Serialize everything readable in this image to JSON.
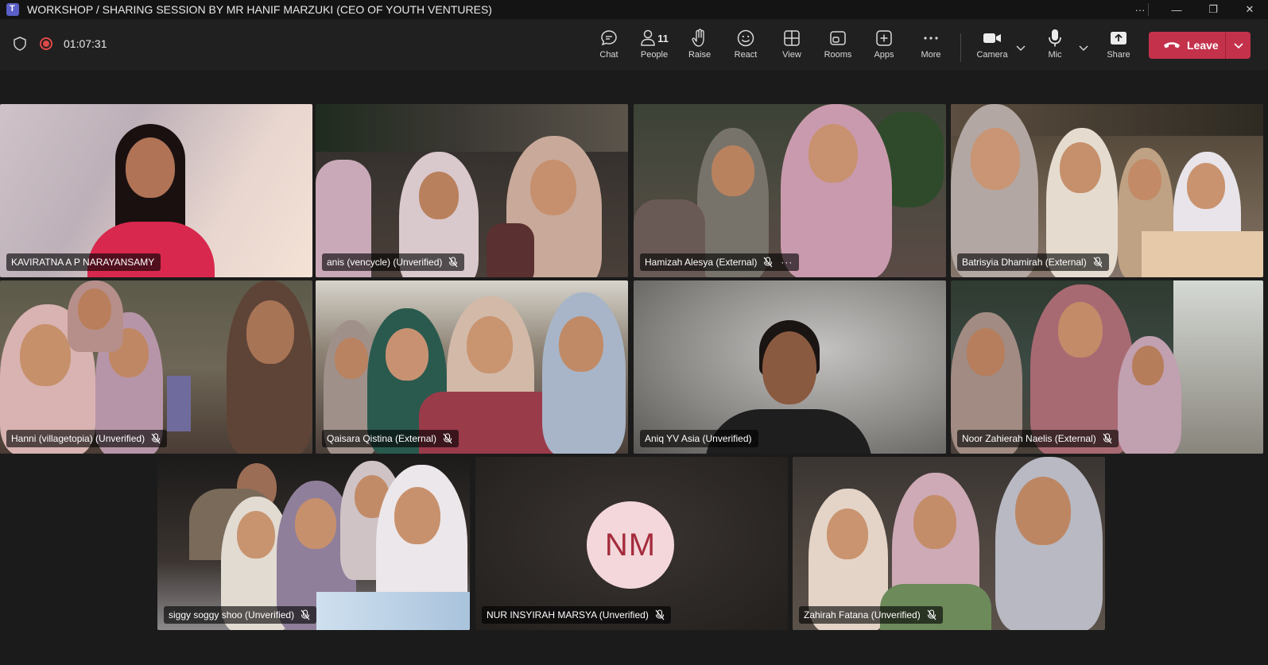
{
  "window": {
    "title": "WORKSHOP / SHARING SESSION BY MR HANIF MARZUKI (CEO OF YOUTH VENTURES)",
    "more": "···",
    "minimize": "—",
    "restore": "❐",
    "close": "✕"
  },
  "meeting": {
    "timer": "01:07:31"
  },
  "toolbar": {
    "chat": "Chat",
    "people": "People",
    "people_count": "11",
    "raise": "Raise",
    "react": "React",
    "view": "View",
    "rooms": "Rooms",
    "apps": "Apps",
    "more": "More",
    "camera": "Camera",
    "mic": "Mic",
    "share": "Share",
    "leave": "Leave"
  },
  "participants": [
    {
      "name": "KAVIRATNA A P NARAYANSAMY",
      "muted": false
    },
    {
      "name": "anis (vencycle) (Unverified)",
      "muted": true
    },
    {
      "name": "Hamizah Alesya (External)",
      "muted": true,
      "more": "···"
    },
    {
      "name": "Batrisyia Dhamirah (External)",
      "muted": true
    },
    {
      "name": "Hanni (villagetopia) (Unverified)",
      "muted": true
    },
    {
      "name": "Qaisara Qistina (External)",
      "muted": true
    },
    {
      "name": "Aniq YV Asia (Unverified)",
      "muted": false
    },
    {
      "name": "Noor Zahierah Naelis (External)",
      "muted": true
    },
    {
      "name": "siggy soggy shoo (Unverified)",
      "muted": true
    },
    {
      "name": "NUR INSYIRAH MARSYA (Unverified)",
      "muted": true,
      "initials": "NM"
    },
    {
      "name": "Zahirah Fatana (Unverified)",
      "muted": true
    }
  ],
  "colors": {
    "leave": "#c4314b",
    "record": "#e04848",
    "avatar_bg": "#f3d7da",
    "avatar_text": "#a52b3c"
  }
}
